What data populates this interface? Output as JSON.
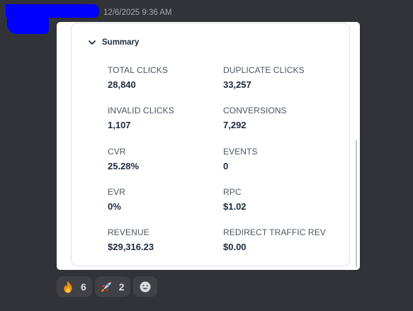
{
  "message": {
    "timestamp": "12/6/2025 9:36 AM"
  },
  "summary": {
    "title": "Summary",
    "metrics": [
      {
        "label": "TOTAL CLICKS",
        "value": "28,840"
      },
      {
        "label": "DUPLICATE CLICKS",
        "value": "33,257"
      },
      {
        "label": "INVALID CLICKS",
        "value": "1,107"
      },
      {
        "label": "CONVERSIONS",
        "value": "7,292"
      },
      {
        "label": "CVR",
        "value": "25.28%"
      },
      {
        "label": "EVENTS",
        "value": "0"
      },
      {
        "label": "EVR",
        "value": "0%"
      },
      {
        "label": "RPC",
        "value": "$1.02"
      },
      {
        "label": "REVENUE",
        "value": "$29,316.23"
      },
      {
        "label": "REDIRECT TRAFFIC REV",
        "value": "$0.00"
      }
    ]
  },
  "reactions": [
    {
      "icon": "fire-icon",
      "count": "6"
    },
    {
      "icon": "rocket-icon",
      "count": "2"
    }
  ],
  "colors": {
    "background": "#323338",
    "card": "#ffffff",
    "redaction": "#0000ff",
    "reaction_bg": "#3f4147"
  }
}
